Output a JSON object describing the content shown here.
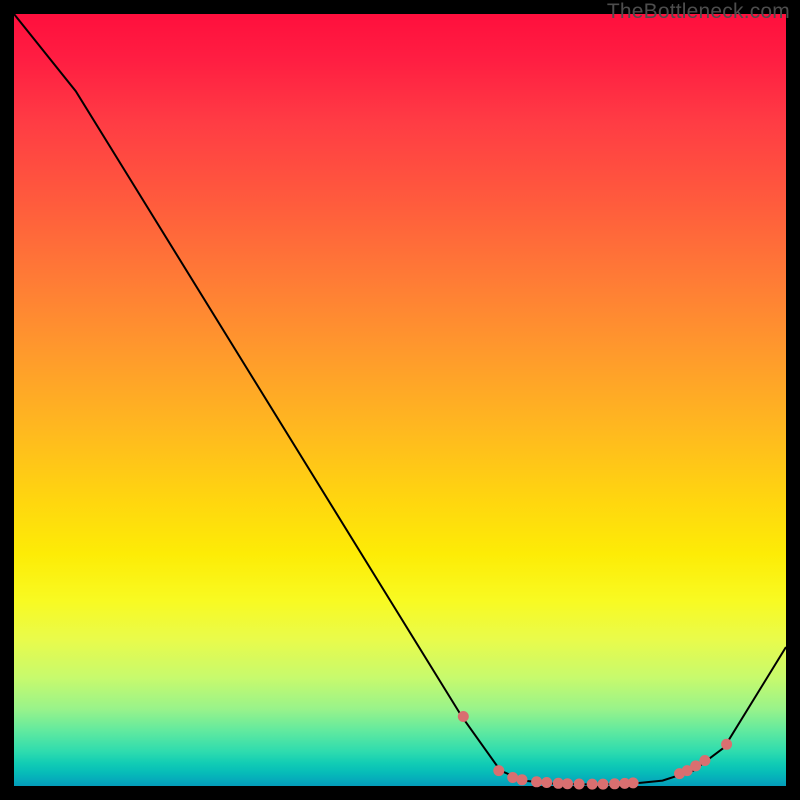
{
  "watermark": "TheBottleneck.com",
  "chart_data": {
    "type": "line",
    "title": "",
    "xlabel": "",
    "ylabel": "",
    "xlim": [
      0,
      100
    ],
    "ylim": [
      0,
      100
    ],
    "grid": false,
    "legend": false,
    "series": [
      {
        "name": "curve",
        "x": [
          0,
          8,
          58,
          63,
          66,
          70,
          75,
          80,
          84,
          88,
          92,
          100
        ],
        "y": [
          100,
          90,
          9,
          2,
          0.7,
          0.3,
          0.2,
          0.3,
          0.7,
          2,
          5,
          18
        ]
      }
    ],
    "markers": [
      {
        "x": 58.2,
        "y": 9.0
      },
      {
        "x": 62.8,
        "y": 2.0
      },
      {
        "x": 64.6,
        "y": 1.1
      },
      {
        "x": 65.8,
        "y": 0.8
      },
      {
        "x": 67.7,
        "y": 0.55
      },
      {
        "x": 69.0,
        "y": 0.45
      },
      {
        "x": 70.5,
        "y": 0.35
      },
      {
        "x": 71.7,
        "y": 0.3
      },
      {
        "x": 73.2,
        "y": 0.26
      },
      {
        "x": 74.9,
        "y": 0.24
      },
      {
        "x": 76.3,
        "y": 0.24
      },
      {
        "x": 77.8,
        "y": 0.28
      },
      {
        "x": 79.1,
        "y": 0.34
      },
      {
        "x": 80.2,
        "y": 0.4
      },
      {
        "x": 86.2,
        "y": 1.6
      },
      {
        "x": 87.2,
        "y": 2.0
      },
      {
        "x": 88.3,
        "y": 2.6
      },
      {
        "x": 89.5,
        "y": 3.3
      },
      {
        "x": 92.3,
        "y": 5.4
      }
    ],
    "colors": {
      "curve": "#000000",
      "markers": "#d96f70"
    }
  }
}
